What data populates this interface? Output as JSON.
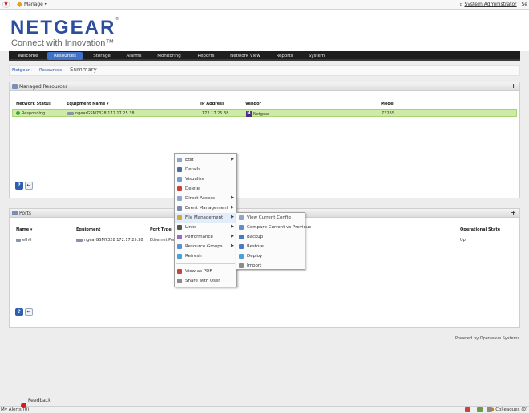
{
  "topbar": {
    "manage_label": "Manage",
    "user_label": "System Administrator"
  },
  "brand": {
    "name": "NETGEAR",
    "tm": "®",
    "tagline": "Connect with Innovation™"
  },
  "nav": {
    "tabs": [
      {
        "label": "Welcome"
      },
      {
        "label": "Resources"
      },
      {
        "label": "Storage"
      },
      {
        "label": "Alarms"
      },
      {
        "label": "Monitoring"
      },
      {
        "label": "Reports"
      },
      {
        "label": "Network View"
      },
      {
        "label": "Reports"
      },
      {
        "label": "System"
      }
    ]
  },
  "breadcrumb": {
    "root": "Netgear",
    "resources": "Resources",
    "current": "Summary"
  },
  "managed": {
    "title": "Managed Resources",
    "columns": {
      "status": "Network Status",
      "equipment": "Equipment Name",
      "ip": "IP Address",
      "vendor": "Vendor",
      "model": "Model"
    },
    "row": {
      "status": "Responding",
      "equipment": "ngearGSM7328 172.17.25.38",
      "ip": "172.17.25.38",
      "vendor": "Netgear",
      "model": "7328S"
    }
  },
  "ports": {
    "title": "Ports",
    "columns": {
      "name": "Name",
      "equipment": "Equipment",
      "port_type": "Port Type",
      "op_state": "Operational State"
    },
    "row": {
      "name": "eth0",
      "equipment": "ngearGSM7328 172.17.25.38",
      "port_type": "Ethernet Port",
      "op_state": "Up"
    }
  },
  "context_menu": {
    "items": [
      {
        "label": "Edit",
        "sub": true,
        "color": "#8fa4c8"
      },
      {
        "label": "Details",
        "sub": false,
        "color": "#4f6d9a"
      },
      {
        "label": "Visualize",
        "sub": false,
        "color": "#6aa0d8"
      },
      {
        "label": "Delete",
        "sub": false,
        "color": "#c9433a"
      },
      {
        "label": "Direct Access",
        "sub": true,
        "color": "#8fa4c8"
      },
      {
        "label": "Event Management",
        "sub": true,
        "color": "#7a88a8"
      },
      {
        "label": "File Management",
        "sub": true,
        "color": "#d0a83a"
      },
      {
        "label": "Links",
        "sub": true,
        "color": "#555555"
      },
      {
        "label": "Performance",
        "sub": true,
        "color": "#9a6ac0"
      },
      {
        "label": "Resource Groups",
        "sub": true,
        "color": "#5c8fd0"
      },
      {
        "label": "Refresh",
        "sub": false,
        "color": "#4aa0d8"
      },
      {
        "label": "View as PDF",
        "sub": false,
        "color": "#c9433a"
      },
      {
        "label": "Share with User",
        "sub": false,
        "color": "#8a8a8a"
      }
    ]
  },
  "submenu": {
    "items": [
      {
        "label": "View Current Config",
        "color": "#8fa4c8"
      },
      {
        "label": "Compare Current vs Previous",
        "color": "#5c8fd0"
      },
      {
        "label": "Backup",
        "color": "#4a7ac0"
      },
      {
        "label": "Restore",
        "color": "#4a7ac0"
      },
      {
        "label": "Deploy",
        "color": "#4aa0d8"
      },
      {
        "label": "Import",
        "color": "#8a8a8a"
      }
    ]
  },
  "footer": {
    "powered_by": "Powered by Openwave Systems",
    "feedback": "Feedback",
    "my_alerts": "My Alerts (0)",
    "collaborators": "Colleagues (0)"
  }
}
